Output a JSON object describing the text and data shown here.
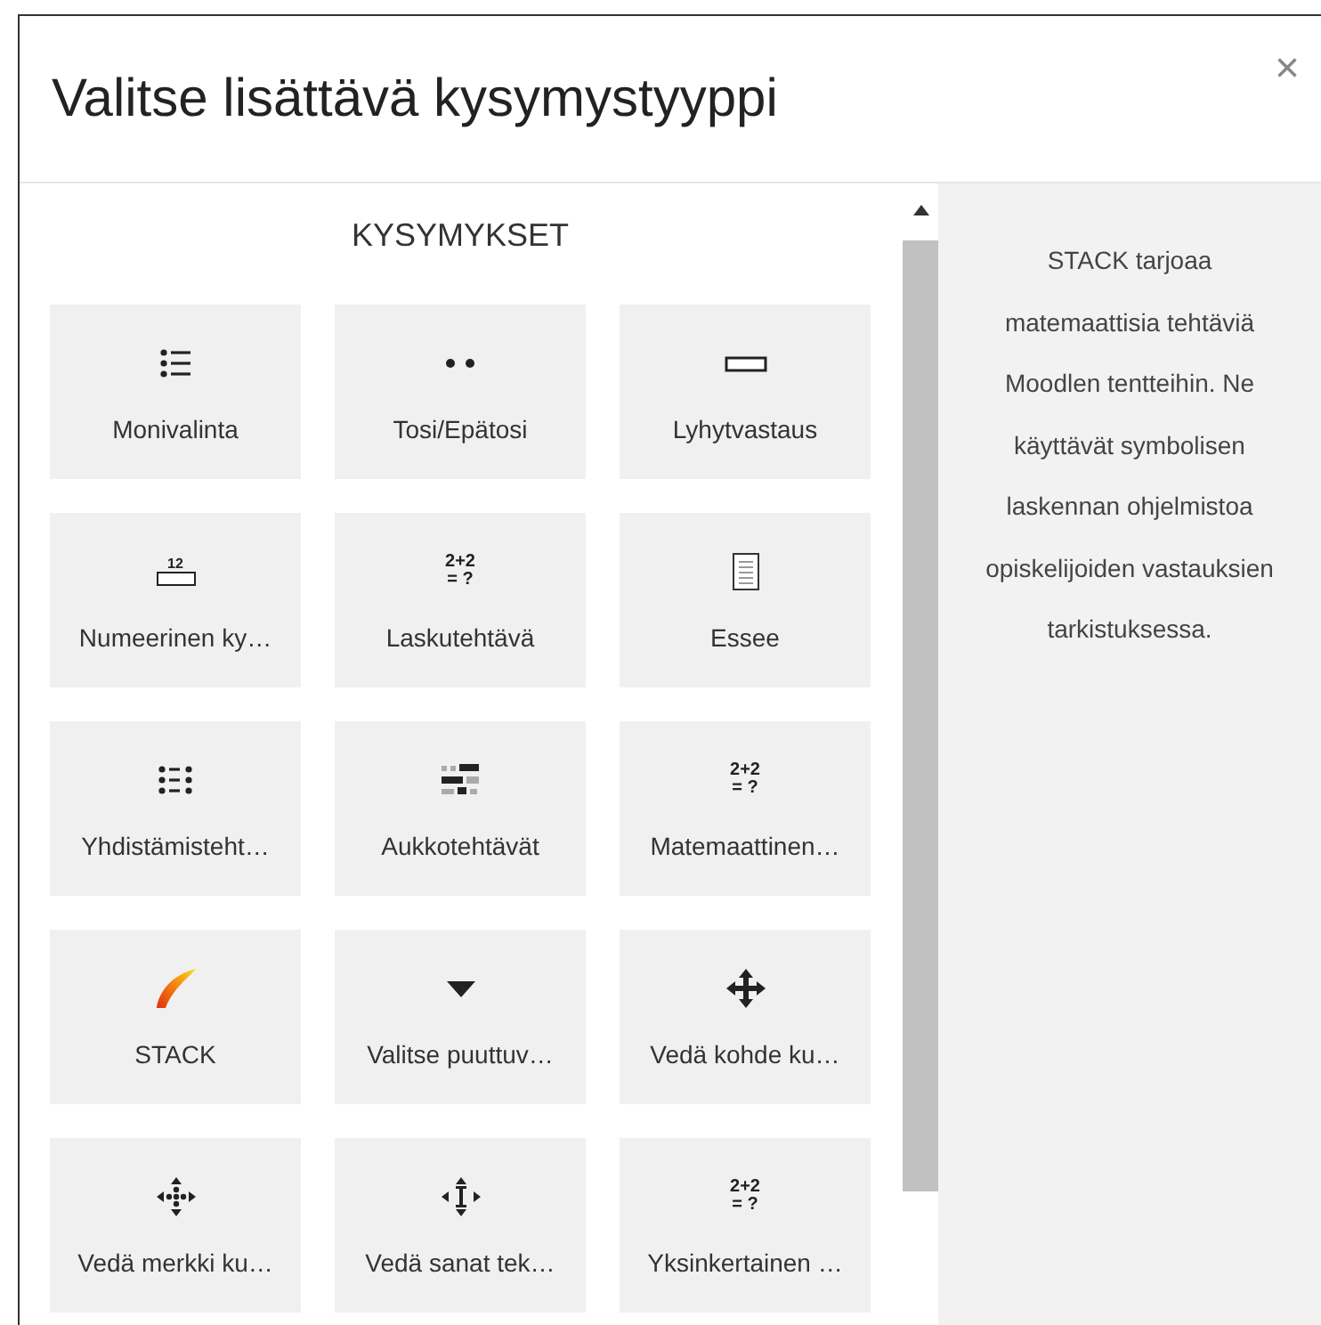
{
  "dialog": {
    "title": "Valitse lisättävä kysymystyyppi",
    "close": "×"
  },
  "section": {
    "heading": "KYSYMYKSET"
  },
  "question_types": [
    {
      "label": "Monivalinta",
      "kind": "list"
    },
    {
      "label": "Tosi/Epätosi",
      "kind": "dots"
    },
    {
      "label": "Lyhytvastaus",
      "kind": "field"
    },
    {
      "label": "Numeerinen ky…",
      "kind": "numfield",
      "icon_text": [
        "12"
      ]
    },
    {
      "label": "Laskutehtävä",
      "kind": "formula",
      "icon_text": [
        "2+2",
        "= ?"
      ]
    },
    {
      "label": "Essee",
      "kind": "page"
    },
    {
      "label": "Yhdistämisteht…",
      "kind": "match"
    },
    {
      "label": "Aukkotehtävät",
      "kind": "gaps"
    },
    {
      "label": "Matemaattinen…",
      "kind": "formula",
      "icon_text": [
        "2+2",
        "= ?"
      ]
    },
    {
      "label": "STACK",
      "kind": "stack"
    },
    {
      "label": "Valitse puuttuv…",
      "kind": "caret"
    },
    {
      "label": "Vedä kohde ku…",
      "kind": "move"
    },
    {
      "label": "Vedä merkki ku…",
      "kind": "movedots"
    },
    {
      "label": "Vedä sanat tek…",
      "kind": "movetext"
    },
    {
      "label": "Yksinkertainen …",
      "kind": "formula",
      "icon_text": [
        "2+2",
        "= ?"
      ]
    }
  ],
  "description": "STACK tarjoaa matemaattisia tehtäviä Moodlen tentteihin. Ne käyttävät symbolisen laskennan ohjelmistoa opiskelijoiden vastauksien tarkistuksessa."
}
